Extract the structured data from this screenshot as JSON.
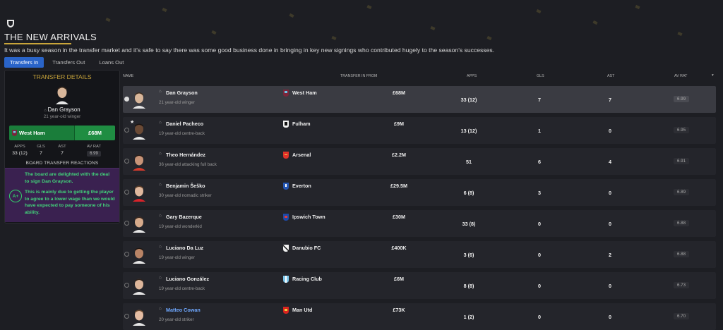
{
  "page": {
    "title": "THE NEW ARRIVALS",
    "intro": "It was a busy season in the transfer market and it's safe to say there was some good business done in bringing in key new signings who contributed hugely to the season's successes."
  },
  "tabs": [
    {
      "label": "Transfers In",
      "active": true
    },
    {
      "label": "Transfers Out",
      "active": false
    },
    {
      "label": "Loans Out",
      "active": false
    }
  ],
  "details": {
    "title": "TRANSFER DETAILS",
    "name": "Dan Grayson",
    "sub": "21 year-old winger",
    "club": "West Ham",
    "fee": "£68M",
    "stat_labels": [
      "APPS",
      "GLS",
      "AST",
      "AV RAT"
    ],
    "stat_values": [
      "33 (12)",
      "7",
      "7",
      "6.99"
    ],
    "reactions_title": "BOARD TRANSFER REACTIONS",
    "grade": "A+",
    "reaction_1": "The board are delighted with the deal to sign Dan Grayson.",
    "reaction_2": "This is mainly due to getting the player to agree to a lower wage than we would have expected to pay someone of his ability."
  },
  "table": {
    "headers": {
      "name": "NAME",
      "from": "TRANSFER IN FROM",
      "apps": "APPS",
      "gls": "GLS",
      "ast": "AST",
      "avrat": "AV RAT"
    },
    "rows": [
      {
        "name": "Dan Grayson",
        "sub": "21 year-old winger",
        "club": "West Ham",
        "fee": "£68M",
        "apps": "33 (12)",
        "gls": "7",
        "ast": "7",
        "rat": "6.99"
      },
      {
        "name": "Daniel Pacheco",
        "sub": "19 year-old centre-back",
        "club": "Fulham",
        "fee": "£9M",
        "apps": "13 (12)",
        "gls": "1",
        "ast": "0",
        "rat": "6.95"
      },
      {
        "name": "Theo Hernández",
        "sub": "36 year-old attacking full back",
        "club": "Arsenal",
        "fee": "£2.2M",
        "apps": "51",
        "gls": "6",
        "ast": "4",
        "rat": "6.91"
      },
      {
        "name": "Benjamin Šeško",
        "sub": "30 year-old nomadic striker",
        "club": "Everton",
        "fee": "£29.5M",
        "apps": "6 (8)",
        "gls": "3",
        "ast": "0",
        "rat": "6.89"
      },
      {
        "name": "Gary Bazerque",
        "sub": "19 year-old wonderkid",
        "club": "Ipswich Town",
        "fee": "£30M",
        "apps": "33 (8)",
        "gls": "0",
        "ast": "0",
        "rat": "6.88"
      },
      {
        "name": "Luciano Da Luz",
        "sub": "19 year-old winger",
        "club": "Danubio FC",
        "fee": "£400K",
        "apps": "3 (6)",
        "gls": "0",
        "ast": "2",
        "rat": "6.88"
      },
      {
        "name": "Luciano González",
        "sub": "19 year-old centre-back",
        "club": "Racing Club",
        "fee": "£6M",
        "apps": "8 (8)",
        "gls": "0",
        "ast": "0",
        "rat": "6.73"
      },
      {
        "name": "Matteo Cowan",
        "sub": "20 year-old striker",
        "club": "Man Utd",
        "fee": "£73K",
        "apps": "1 (2)",
        "gls": "0",
        "ast": "0",
        "rat": "6.70"
      }
    ]
  },
  "colors": {
    "accent_gold": "#c9a53a",
    "tab_active": "#2a64c8",
    "fee_green": "#1f8d42",
    "reaction_purple": "#3a2150",
    "reaction_text": "#42d47a",
    "link_blue": "#6fa8ff"
  }
}
